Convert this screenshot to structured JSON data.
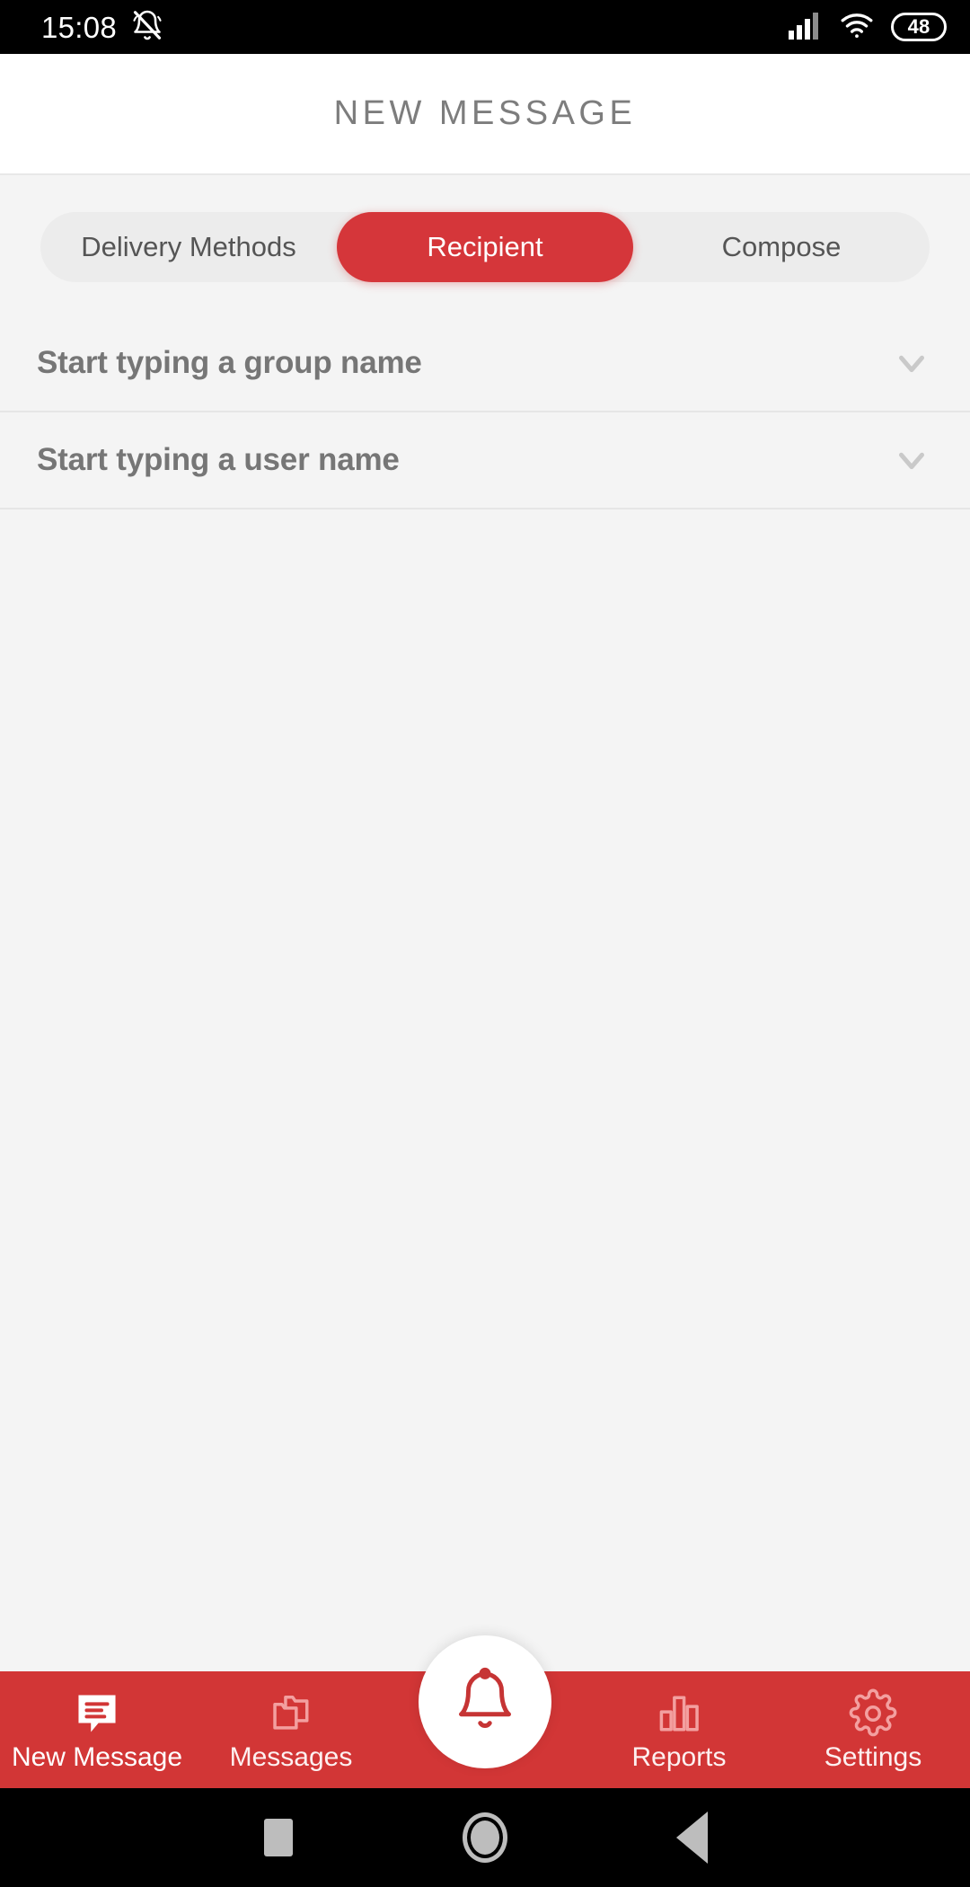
{
  "status_bar": {
    "time": "15:08",
    "notification_icon": "bell-muted-icon",
    "signal_icon": "cellular-signal-icon",
    "wifi_icon": "wifi-icon",
    "battery_level": "48",
    "battery_icon": "battery-icon"
  },
  "header": {
    "title": "NEW MESSAGE"
  },
  "segmented_control": {
    "tabs": [
      {
        "label": "Delivery Methods",
        "active": false
      },
      {
        "label": "Recipient",
        "active": true
      },
      {
        "label": "Compose",
        "active": false
      }
    ],
    "active_color": "#d5363a",
    "track_color": "#ececec"
  },
  "recipient_rows": [
    {
      "label": "Start typing a group name",
      "icon": "chevron-down-icon"
    },
    {
      "label": "Start typing a user name",
      "icon": "chevron-down-icon"
    }
  ],
  "bottom_nav": {
    "background_color": "#d23636",
    "items": [
      {
        "label": "New Message",
        "icon": "chat-bubble-icon",
        "active": true
      },
      {
        "label": "Messages",
        "icon": "folders-icon",
        "active": false
      },
      {
        "label": "Reports",
        "icon": "bar-chart-icon",
        "active": false
      },
      {
        "label": "Settings",
        "icon": "gear-icon",
        "active": false
      }
    ],
    "fab": {
      "icon": "bell-icon"
    }
  },
  "android_nav": {
    "recents": "square-recents-icon",
    "home": "circle-home-icon",
    "back": "triangle-back-icon"
  }
}
